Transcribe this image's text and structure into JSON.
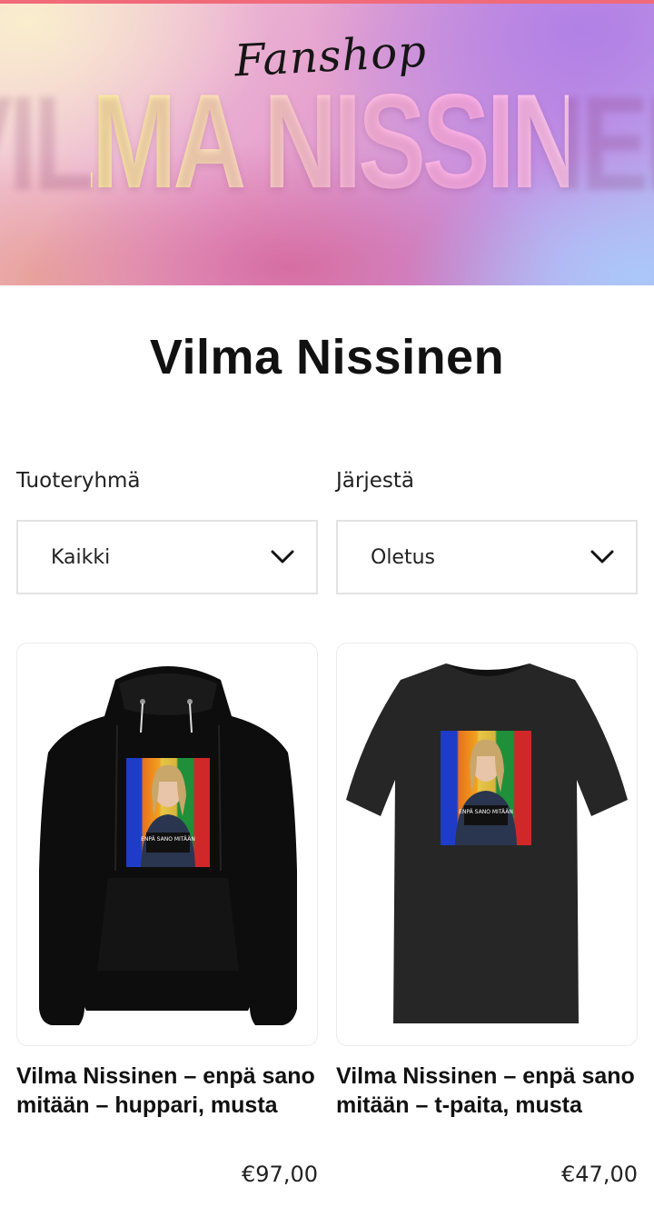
{
  "banner": {
    "script_text": "Fanshop",
    "title_text": "VILMA NISSINEN"
  },
  "page": {
    "title": "Vilma Nissinen"
  },
  "filters": {
    "category": {
      "label": "Tuoteryhmä",
      "value": "Kaikki"
    },
    "sort": {
      "label": "Järjestä",
      "value": "Oletus"
    }
  },
  "print": {
    "sign_text": "ENPÄ SANO MITÄÄN"
  },
  "products": [
    {
      "name": "Vilma Nissinen – enpä sano mitään – huppari, musta",
      "price": "€97,00",
      "image_icon": "black-hoodie-with-print"
    },
    {
      "name": "Vilma Nissinen – enpä sano mitään – t-paita, musta",
      "price": "€47,00",
      "image_icon": "black-tshirt-with-print"
    }
  ],
  "colors": {
    "accent_line": "#f06a7a",
    "garment_hoodie": "#0d0d0d",
    "garment_tshirt": "#262626",
    "border": "#e3e3e3"
  }
}
